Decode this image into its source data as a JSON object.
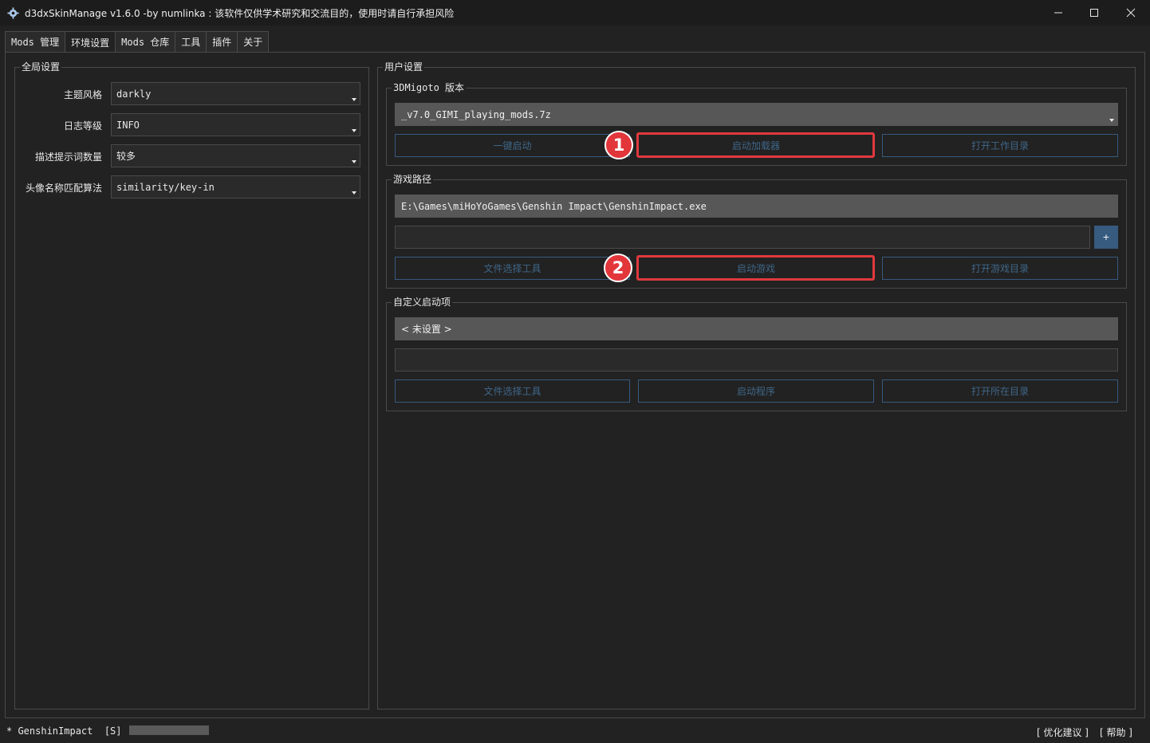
{
  "window": {
    "title": "d3dxSkinManage v1.6.0 -by numlinka : 该软件仅供学术研究和交流目的，使用时请自行承担风险",
    "app_icon": "gear-icon",
    "controls": {
      "minimize": "minimize-icon",
      "maximize": "maximize-icon",
      "close": "close-icon"
    }
  },
  "tabs": [
    {
      "label": "Mods 管理"
    },
    {
      "label": "环境设置",
      "active": true
    },
    {
      "label": "Mods 仓库"
    },
    {
      "label": "工具"
    },
    {
      "label": "插件"
    },
    {
      "label": "关于"
    }
  ],
  "global_settings": {
    "title": "全局设置",
    "rows": [
      {
        "label": "主题风格",
        "value": "darkly"
      },
      {
        "label": "日志等级",
        "value": "INFO"
      },
      {
        "label": "描述提示词数量",
        "value": "较多"
      },
      {
        "label": "头像名称匹配算法",
        "value": "similarity/key-in"
      }
    ]
  },
  "user_settings": {
    "title": "用户设置",
    "migoto": {
      "title": "3DMigoto 版本",
      "version": "_v7.0_GIMI_playing_mods.7z",
      "buttons": [
        "一键启动",
        "启动加载器",
        "打开工作目录"
      ]
    },
    "game_path": {
      "title": "游戏路径",
      "path": "E:\\Games\\miHoYoGames\\Genshin Impact\\GenshinImpact.exe",
      "args": "",
      "plus_label": "+",
      "buttons": [
        "文件选择工具",
        "启动游戏",
        "打开游戏目录"
      ]
    },
    "custom_launch": {
      "title": "自定义启动项",
      "value": "< 未设置 >",
      "args": "",
      "buttons": [
        "文件选择工具",
        "启动程序",
        "打开所在目录"
      ]
    }
  },
  "annotations": {
    "badge1": "1",
    "badge2": "2",
    "color": "#e0393e"
  },
  "status": {
    "left": "* GenshinImpact  [S]  -",
    "links": [
      "[ 优化建议 ]",
      "[ 帮助 ]"
    ]
  },
  "colors": {
    "background": "#222222",
    "accent": "#375a7f",
    "field_grey": "#575757"
  }
}
